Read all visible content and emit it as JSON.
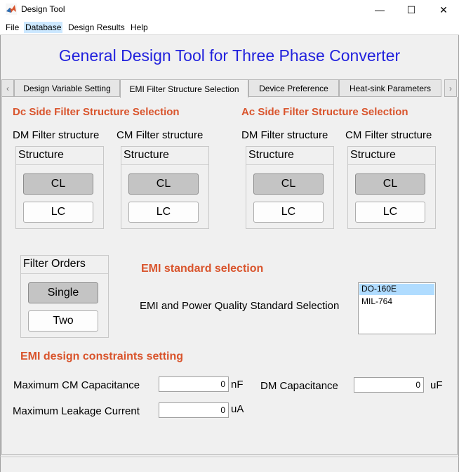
{
  "window": {
    "title": "Design Tool",
    "minimize_glyph": "—",
    "maximize_glyph": "☐",
    "close_glyph": "✕"
  },
  "menu": {
    "items": [
      "File",
      "Database",
      "Design Results",
      "Help"
    ],
    "highlighted": "Database"
  },
  "app": {
    "heading": "General Design Tool for Three Phase Converter"
  },
  "tabs": {
    "items": [
      "Design Variable Setting",
      "EMI Filter Structure Selection",
      "Device Preference",
      "Heat-sink Parameters"
    ],
    "active": "EMI Filter Structure Selection",
    "left_arrow": "‹",
    "right_arrow": "›"
  },
  "dc_section": {
    "title": "Dc Side Filter Structure Selection",
    "dm": {
      "label": "DM Filter structure",
      "group_title": "Structure",
      "options": [
        "CL",
        "LC"
      ],
      "selected": "CL"
    },
    "cm": {
      "label": "CM Filter structure",
      "group_title": "Structure",
      "options": [
        "CL",
        "LC"
      ],
      "selected": "CL"
    }
  },
  "ac_section": {
    "title": "Ac Side Filter Structure Selection",
    "dm": {
      "label": "DM Filter structure",
      "group_title": "Structure",
      "options": [
        "CL",
        "LC"
      ],
      "selected": "CL"
    },
    "cm": {
      "label": "CM Filter structure",
      "group_title": "Structure",
      "options": [
        "CL",
        "LC"
      ],
      "selected": "CL"
    }
  },
  "filter_orders": {
    "title": "Filter Orders",
    "options": [
      "Single",
      "Two"
    ],
    "selected": "Single"
  },
  "emi_standard": {
    "title": "EMI standard selection",
    "label": "EMI and Power Quality Standard Selection",
    "options": [
      "DO-160E",
      "MIL-764"
    ],
    "selected": "DO-160E"
  },
  "constraints": {
    "title": "EMI design constraints setting",
    "max_cm_cap": {
      "label": "Maximum CM Capacitance",
      "value": "0",
      "unit": "nF"
    },
    "dm_cap": {
      "label": "DM Capacitance",
      "value": "0",
      "unit": "uF"
    },
    "max_leakage": {
      "label": "Maximum Leakage Current",
      "value": "0",
      "unit": "uA"
    }
  },
  "colors": {
    "heading": "#2222dd",
    "section_title": "#d9542c",
    "selected_list": "#b0dcff",
    "menu_highlight": "#cce8ff"
  }
}
